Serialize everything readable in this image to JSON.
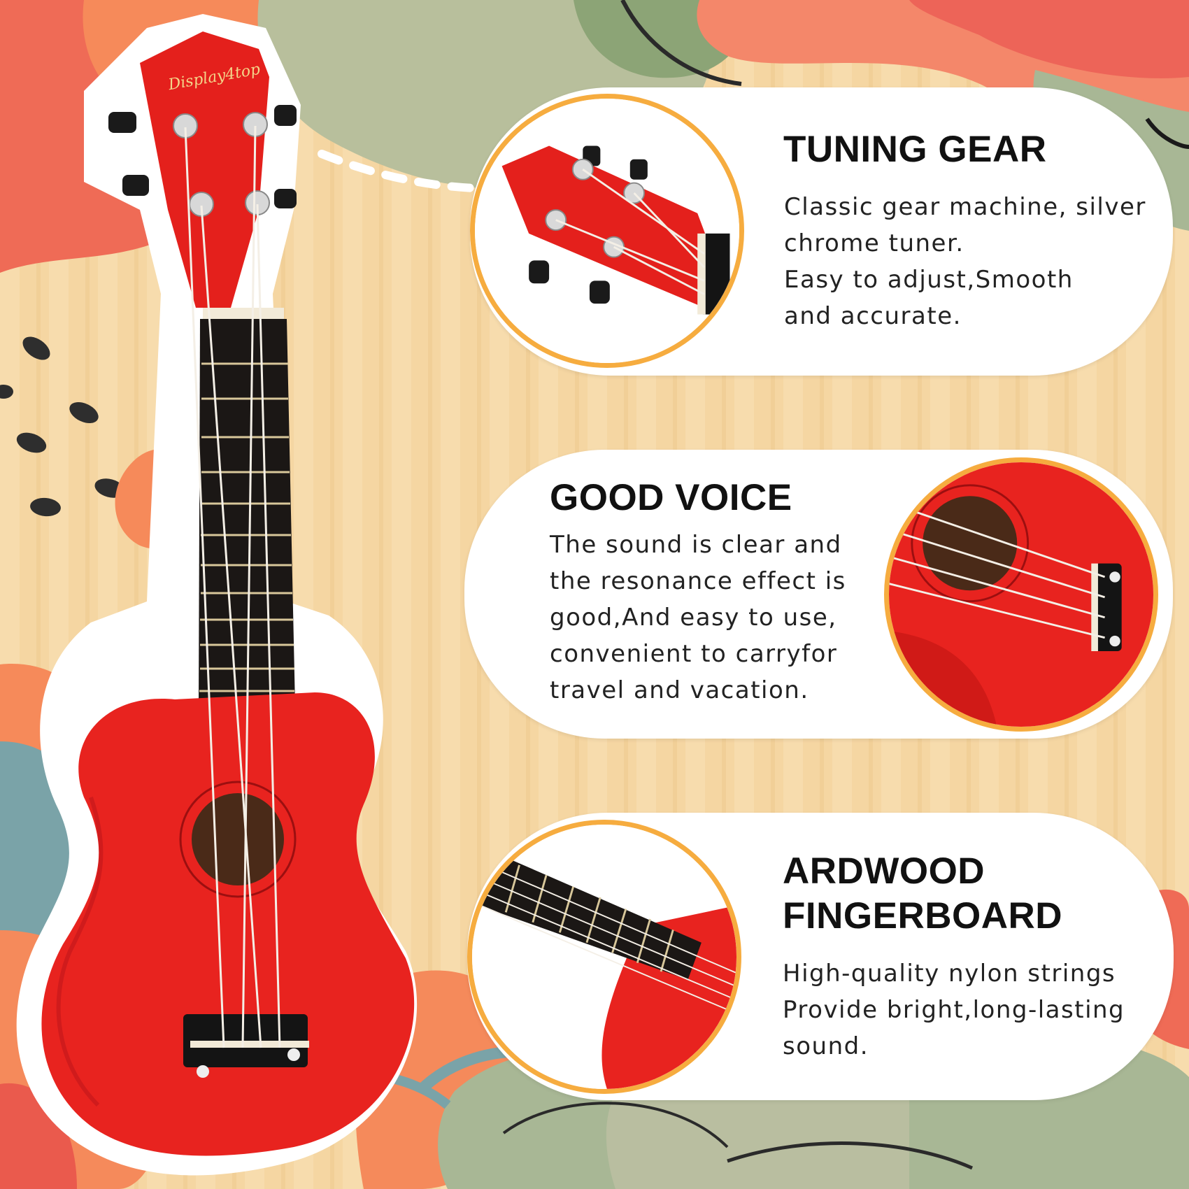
{
  "brand": "Display4top",
  "colors": {
    "accent_ring": "#f6ac3f",
    "ukulele_red": "#e8231f",
    "fretboard": "#1b1715"
  },
  "features": [
    {
      "title": [
        "TUNING GEAR"
      ],
      "lines": [
        "Classic gear machine, silver",
        "chrome tuner.",
        "Easy to adjust,Smooth",
        "and accurate."
      ],
      "icon": "headstock-closeup-image"
    },
    {
      "title": [
        "GOOD VOICE"
      ],
      "lines": [
        "The sound is clear and",
        "the resonance effect is",
        "good,And easy to use,",
        "convenient to carryfor",
        "travel and vacation."
      ],
      "icon": "soundhole-bridge-closeup-image"
    },
    {
      "title": [
        "ARDWOOD",
        "FINGERBOARD"
      ],
      "lines": [
        "High-quality nylon strings",
        "Provide bright,long-lasting",
        "sound."
      ],
      "icon": "fingerboard-closeup-image"
    }
  ]
}
